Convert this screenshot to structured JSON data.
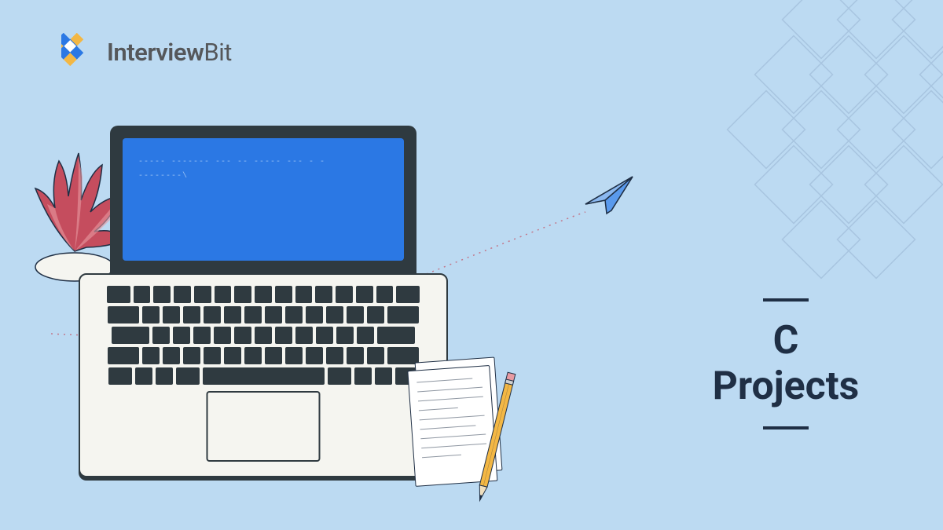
{
  "brand": {
    "name_part1": "Interview",
    "name_part2": "Bit"
  },
  "title": {
    "line1": "C",
    "line2": "Projects"
  },
  "code_lines": [
    "----- ------- --- --    ----- --- - -",
    "--------\\"
  ],
  "colors": {
    "background": "#bcdaf2",
    "dark": "#1f2f45",
    "laptop_frame": "#2f3a40",
    "screen": "#2b78e4",
    "plant_leaf": "#c54d5e",
    "plant_leaf_light": "#e89aa2",
    "pencil": "#f3b744",
    "plane": "#2b78e4"
  }
}
